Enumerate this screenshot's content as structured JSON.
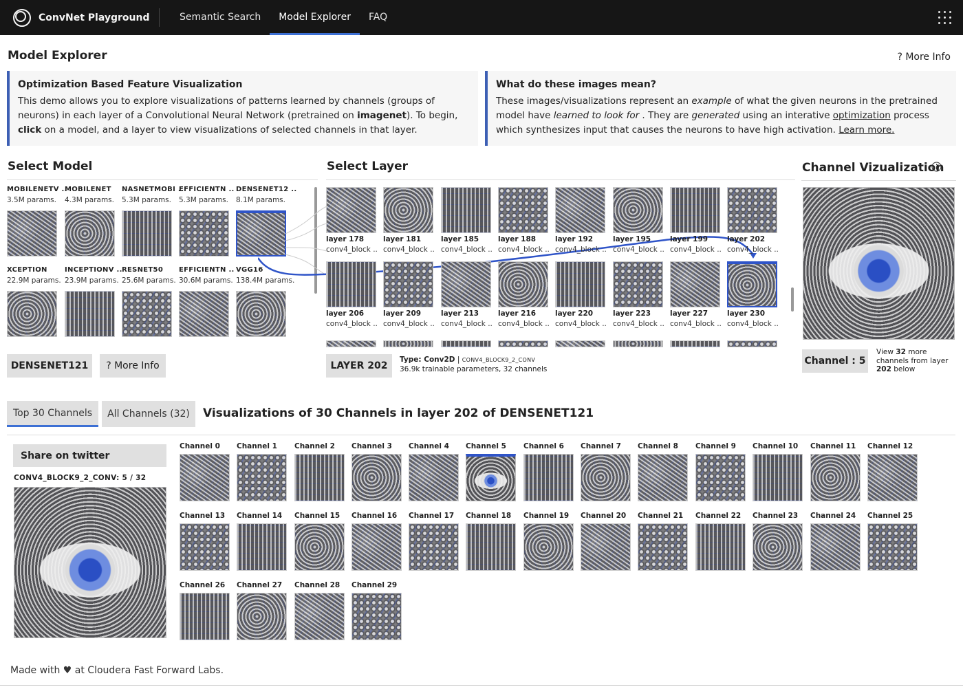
{
  "header": {
    "app_name": "ConvNet Playground",
    "nav": [
      {
        "label": "Semantic Search",
        "active": false
      },
      {
        "label": "Model Explorer",
        "active": true
      },
      {
        "label": "FAQ",
        "active": false
      }
    ]
  },
  "page": {
    "title": "Model Explorer",
    "more_info": "? More Info"
  },
  "intro": {
    "left_title": "Optimization Based Feature Visualization",
    "left_text_1": "This demo allows you to explore visualizations of patterns learned by channels (groups of neurons) in each layer of a Convolutional Neural Network (pretrained on ",
    "left_bold_1": "imagenet",
    "left_text_2": "). To begin, ",
    "left_bold_2": "click",
    "left_text_3": " on a model, and a layer to view visualizations of selected channels in that layer.",
    "right_title": "What do these images mean?",
    "right_text_1": "These images/visualizations represent an ",
    "right_em_1": "example",
    "right_text_2": " of what the given neurons in the pretrained model have ",
    "right_em_2": "learned to look for",
    "right_text_3": " . They are ",
    "right_em_3": "generated",
    "right_text_4": " using an interative ",
    "right_link_1": "optimization",
    "right_text_5": " process which synthesizes input that causes the neurons to have high activation. ",
    "right_link_2": "Learn more."
  },
  "select_model": {
    "title": "Select Model",
    "models": [
      {
        "name": "MOBILENETV ..",
        "params": "3.5M params."
      },
      {
        "name": "MOBILENET",
        "params": "4.3M params."
      },
      {
        "name": "NASNETMOBI ..",
        "params": "5.3M params."
      },
      {
        "name": "EFFICIENTN ..",
        "params": "5.3M params."
      },
      {
        "name": "DENSENET12 ..",
        "params": "8.1M params.",
        "selected": true
      },
      {
        "name": "XCEPTION",
        "params": "22.9M params."
      },
      {
        "name": "INCEPTIONV ..",
        "params": "23.9M params."
      },
      {
        "name": "RESNET50",
        "params": "25.6M params."
      },
      {
        "name": "EFFICIENTN ..",
        "params": "30.6M params."
      },
      {
        "name": "VGG16",
        "params": "138.4M params."
      }
    ],
    "selected_button": "DENSENET121",
    "more_info": "? More Info"
  },
  "select_layer": {
    "title": "Select Layer",
    "row1": [
      {
        "name": "layer 178",
        "sub": "conv4_block .."
      },
      {
        "name": "layer 181",
        "sub": "conv4_block .."
      },
      {
        "name": "layer 185",
        "sub": "conv4_block .."
      },
      {
        "name": "layer 188",
        "sub": "conv4_block .."
      },
      {
        "name": "layer 192",
        "sub": "conv4_block .."
      },
      {
        "name": "layer 195",
        "sub": "conv4_block .."
      },
      {
        "name": "layer 199",
        "sub": "conv4_block .."
      },
      {
        "name": "layer 202",
        "sub": "conv4_block .."
      }
    ],
    "row2": [
      {
        "name": "layer 206",
        "sub": "conv4_block .."
      },
      {
        "name": "layer 209",
        "sub": "conv4_block .."
      },
      {
        "name": "layer 213",
        "sub": "conv4_block .."
      },
      {
        "name": "layer 216",
        "sub": "conv4_block .."
      },
      {
        "name": "layer 220",
        "sub": "conv4_block .."
      },
      {
        "name": "layer 223",
        "sub": "conv4_block .."
      },
      {
        "name": "layer 227",
        "sub": "conv4_block .."
      },
      {
        "name": "layer 230",
        "sub": "conv4_block .."
      }
    ],
    "selected_button": "LAYER 202",
    "type_label": "Type: Conv2D",
    "type_sep": "|",
    "type_name": "CONV4_BLOCK9_2_CONV",
    "type_details": "36.9k trainable parameters, 32 channels"
  },
  "channel_viz": {
    "title": "Channel Vizualization",
    "info_icon": "info-icon",
    "channel_button": "Channel : 5",
    "view_text_1": "View ",
    "view_count": "32",
    "view_text_2": " more channels from layer ",
    "view_layer": "202",
    "view_text_3": " below"
  },
  "bottom": {
    "tabs": [
      {
        "label": "Top 30 Channels",
        "active": true
      },
      {
        "label": "All Channels (32)",
        "active": false
      }
    ],
    "heading": "Visualizations of 30 Channels in layer 202 of DENSENET121",
    "share_button": "Share on twitter",
    "detail_label": "CONV4_BLOCK9_2_CONV: 5 / 32",
    "channels": [
      "Channel 0",
      "Channel 1",
      "Channel 2",
      "Channel 3",
      "Channel 4",
      "Channel 5",
      "Channel 6",
      "Channel 7",
      "Channel 8",
      "Channel 9",
      "Channel 10",
      "Channel 11",
      "Channel 12",
      "Channel 13",
      "Channel 14",
      "Channel 15",
      "Channel 16",
      "Channel 17",
      "Channel 18",
      "Channel 19",
      "Channel 20",
      "Channel 21",
      "Channel 22",
      "Channel 23",
      "Channel 24",
      "Channel 25",
      "Channel 26",
      "Channel 27",
      "Channel 28",
      "Channel 29"
    ],
    "selected_channel_index": 5
  },
  "footer": {
    "text_1": "Made with ",
    "heart": "♥",
    "text_2": " at ",
    "link": "Cloudera Fast Forward Labs."
  },
  "colors": {
    "accent": "#3d70d4",
    "header_bg": "#161616",
    "selection_blue": "#2f54c8"
  }
}
